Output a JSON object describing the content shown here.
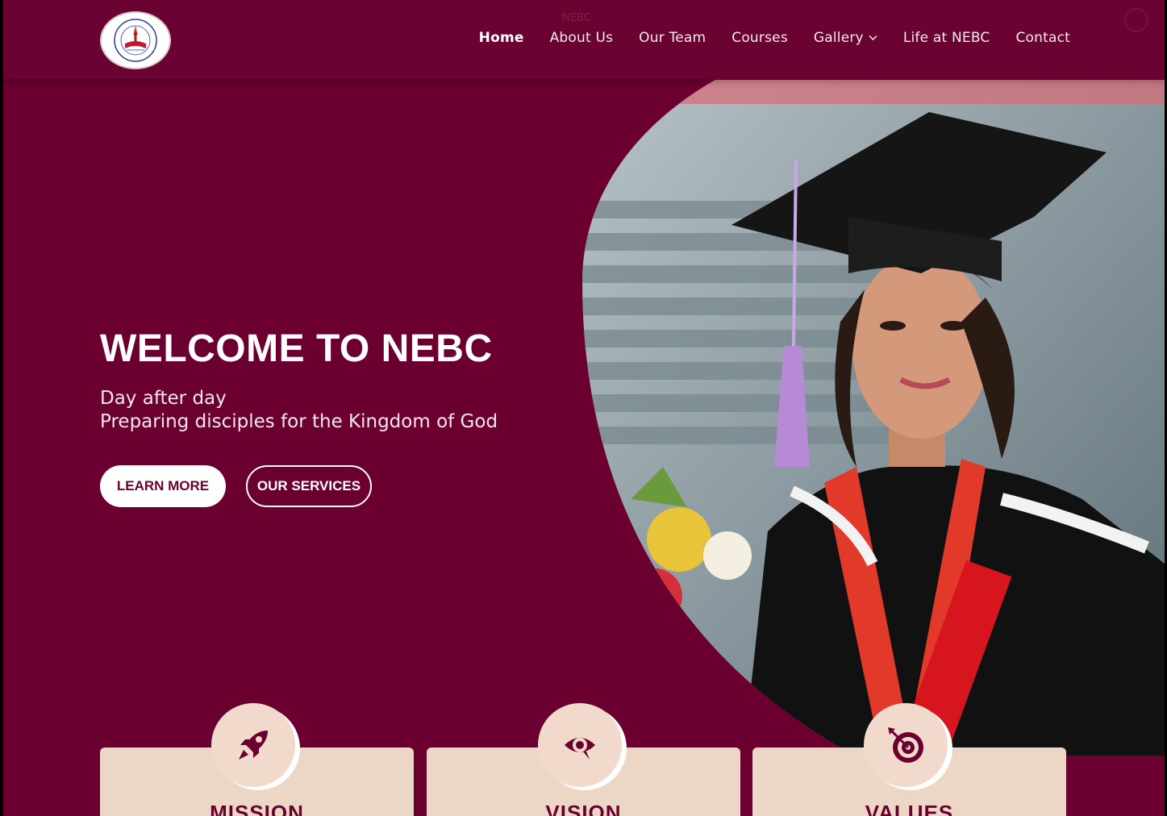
{
  "header": {
    "logo_alt": "Nepal Ebenezer Bible College logo",
    "ghost_text": "NEBC",
    "nav": [
      {
        "label": "Home",
        "active": true
      },
      {
        "label": "About Us"
      },
      {
        "label": "Our Team"
      },
      {
        "label": "Courses"
      },
      {
        "label": "Gallery",
        "dropdown": true
      },
      {
        "label": "Life at NEBC"
      },
      {
        "label": "Contact"
      }
    ]
  },
  "hero": {
    "title": "WELCOME TO NEBC",
    "subtitle_line1": "Day after day",
    "subtitle_line2": "Preparing disciples for the Kingdom of God",
    "primary_button": "LEARN MORE",
    "secondary_button": "OUR SERVICES",
    "image_description": "Graduate wearing cap and gown"
  },
  "cards": [
    {
      "title": "MISSION",
      "icon": "rocket-icon"
    },
    {
      "title": "VISION",
      "icon": "eye-icon"
    },
    {
      "title": "VALUES",
      "icon": "target-icon"
    }
  ],
  "colors": {
    "brand": "#6b0030",
    "card_bg": "#ecd6c6",
    "text_light": "#ffffff"
  }
}
